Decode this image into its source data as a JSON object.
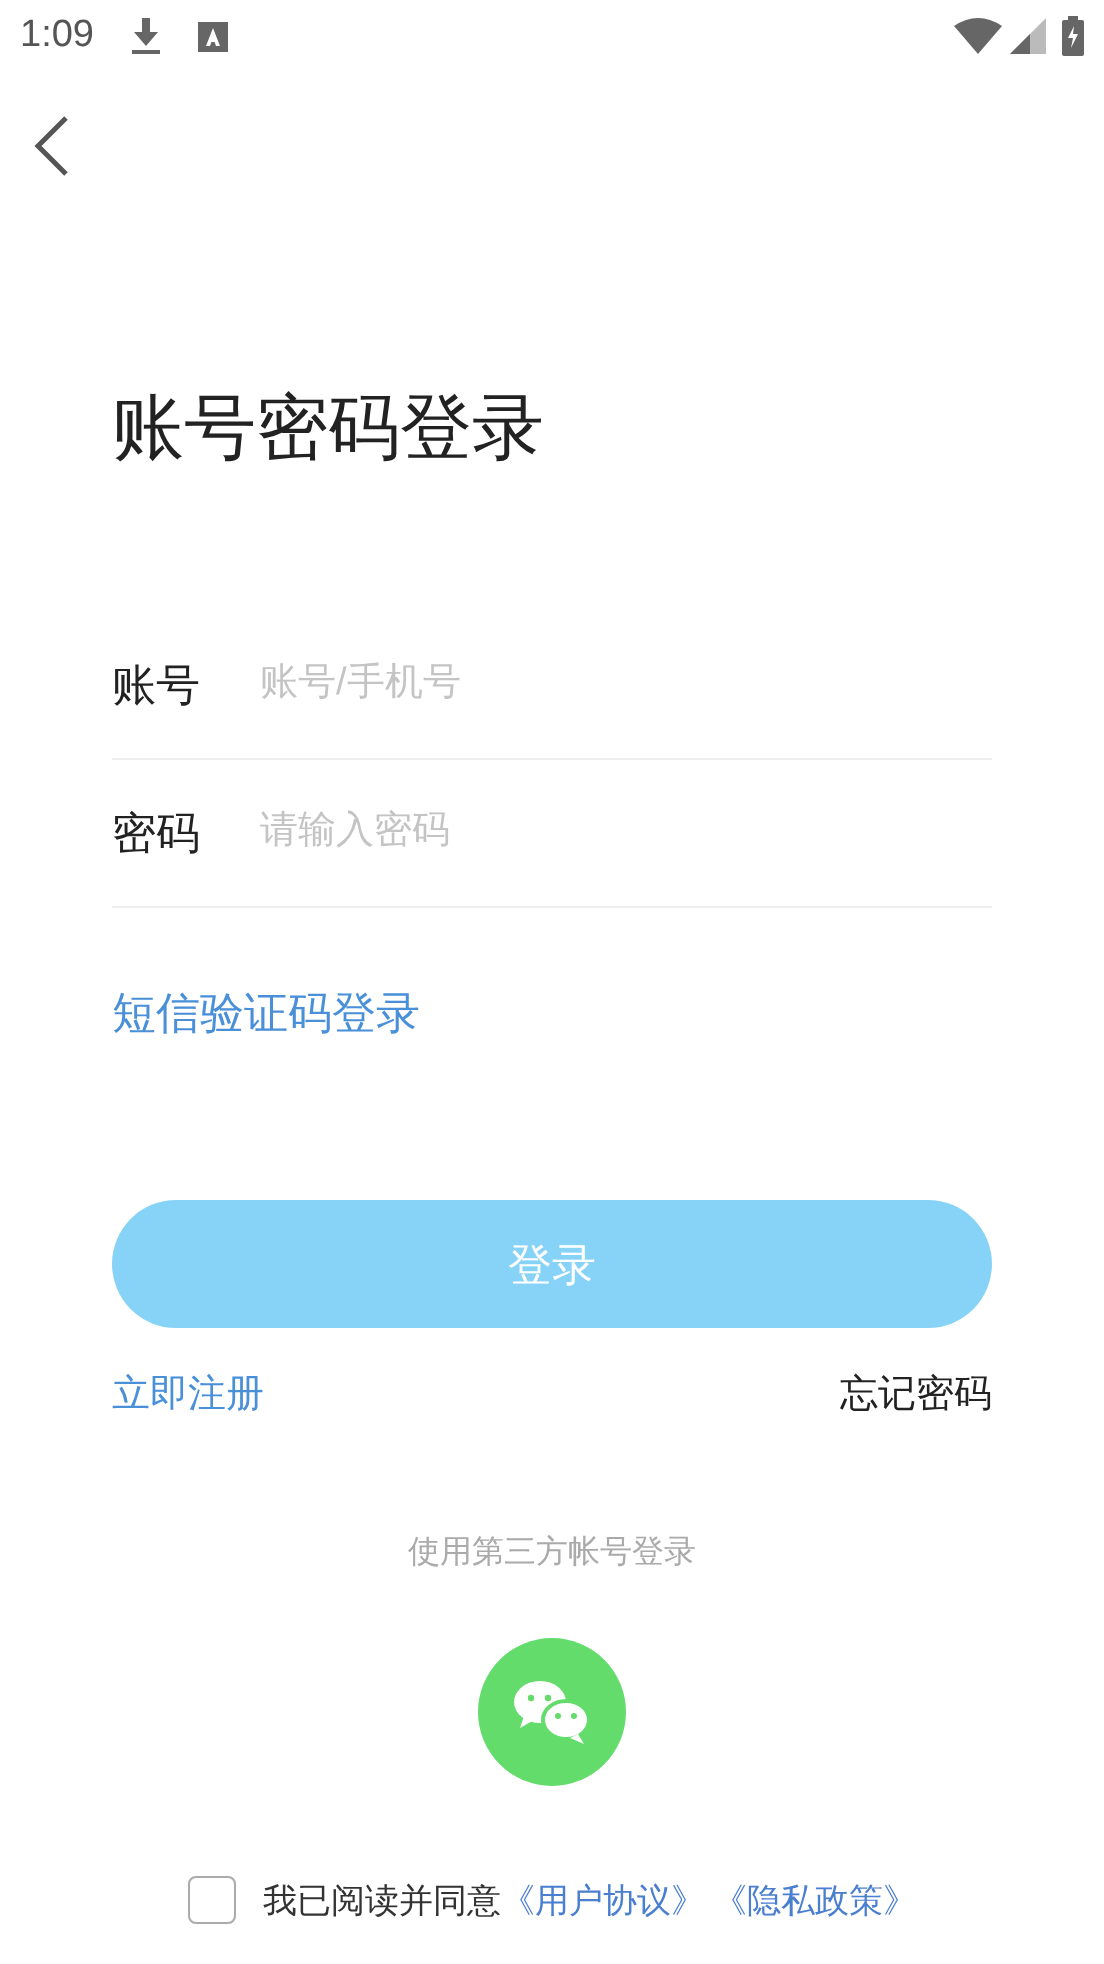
{
  "status_bar": {
    "time": "1:09"
  },
  "title": "账号密码登录",
  "fields": [
    {
      "label": "账号",
      "placeholder": "账号/手机号"
    },
    {
      "label": "密码",
      "placeholder": "请输入密码"
    }
  ],
  "sms_login_link": "短信验证码登录",
  "login_button": {
    "label": "登录",
    "disabled": true
  },
  "register_link": "立即注册",
  "forgot_password_link": "忘记密码",
  "third_party_caption": "使用第三方帐号登录",
  "agreement": {
    "checked": false,
    "text": "我已阅读并同意",
    "links": [
      "《用户协议》",
      "《隐私政策》"
    ]
  }
}
